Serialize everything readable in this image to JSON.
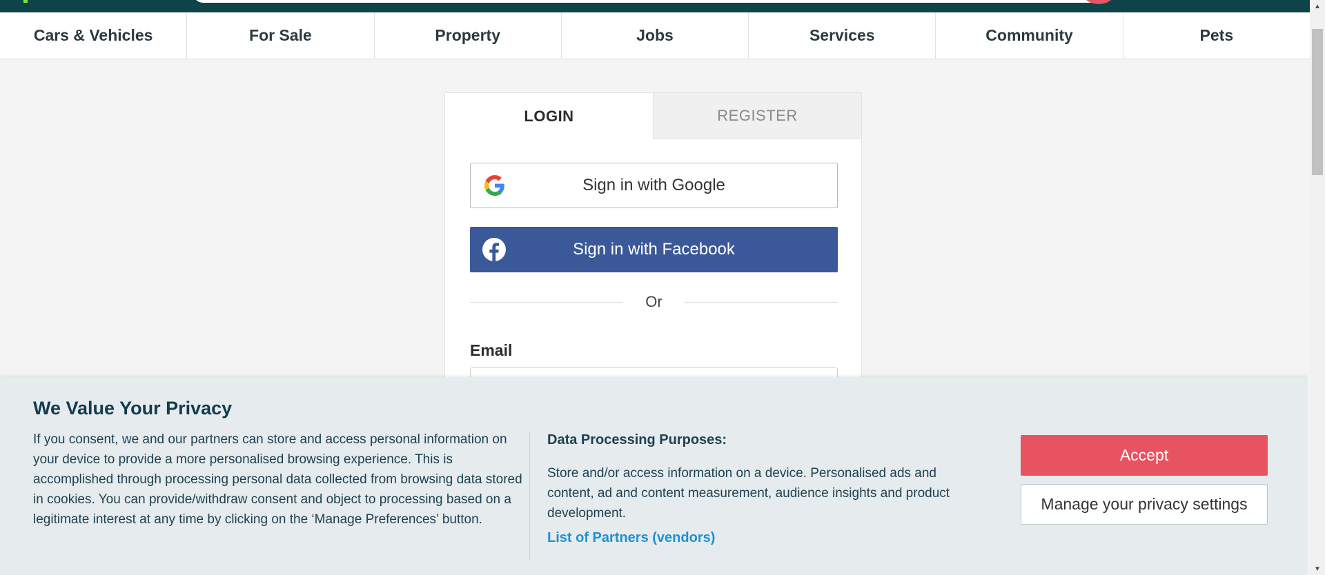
{
  "categories": [
    "Cars & Vehicles",
    "For Sale",
    "Property",
    "Jobs",
    "Services",
    "Community",
    "Pets"
  ],
  "login": {
    "tab_login": "LOGIN",
    "tab_register": "REGISTER",
    "google_label": "Sign in with Google",
    "facebook_label": "Sign in with Facebook",
    "or_text": "Or",
    "email_label": "Email",
    "email_value": ""
  },
  "privacy": {
    "title": "We Value Your Privacy",
    "consent_text": "If you consent, we and our partners can store and access personal information on your device to provide a more personalised browsing experience. This is accomplished through processing personal data collected from browsing data stored in cookies. You can provide/withdraw consent and object to processing based on a legitimate interest at any time by clicking on the ‘Manage Preferences’ button.",
    "purposes_heading": "Data Processing Purposes:",
    "purposes_text": "Store and/or access information on a device. Personalised ads and content, ad and content measurement, audience insights and product development.",
    "partners_link": "List of Partners (vendors)",
    "accept_label": "Accept",
    "manage_label": "Manage your privacy settings"
  },
  "colors": {
    "header_bg": "#0e4349",
    "accent_red": "#e85362",
    "facebook_blue": "#3b5998",
    "link_blue": "#1e90d6"
  },
  "icons": [
    "google-icon",
    "facebook-icon",
    "scroll-up-icon",
    "scroll-down-icon"
  ]
}
